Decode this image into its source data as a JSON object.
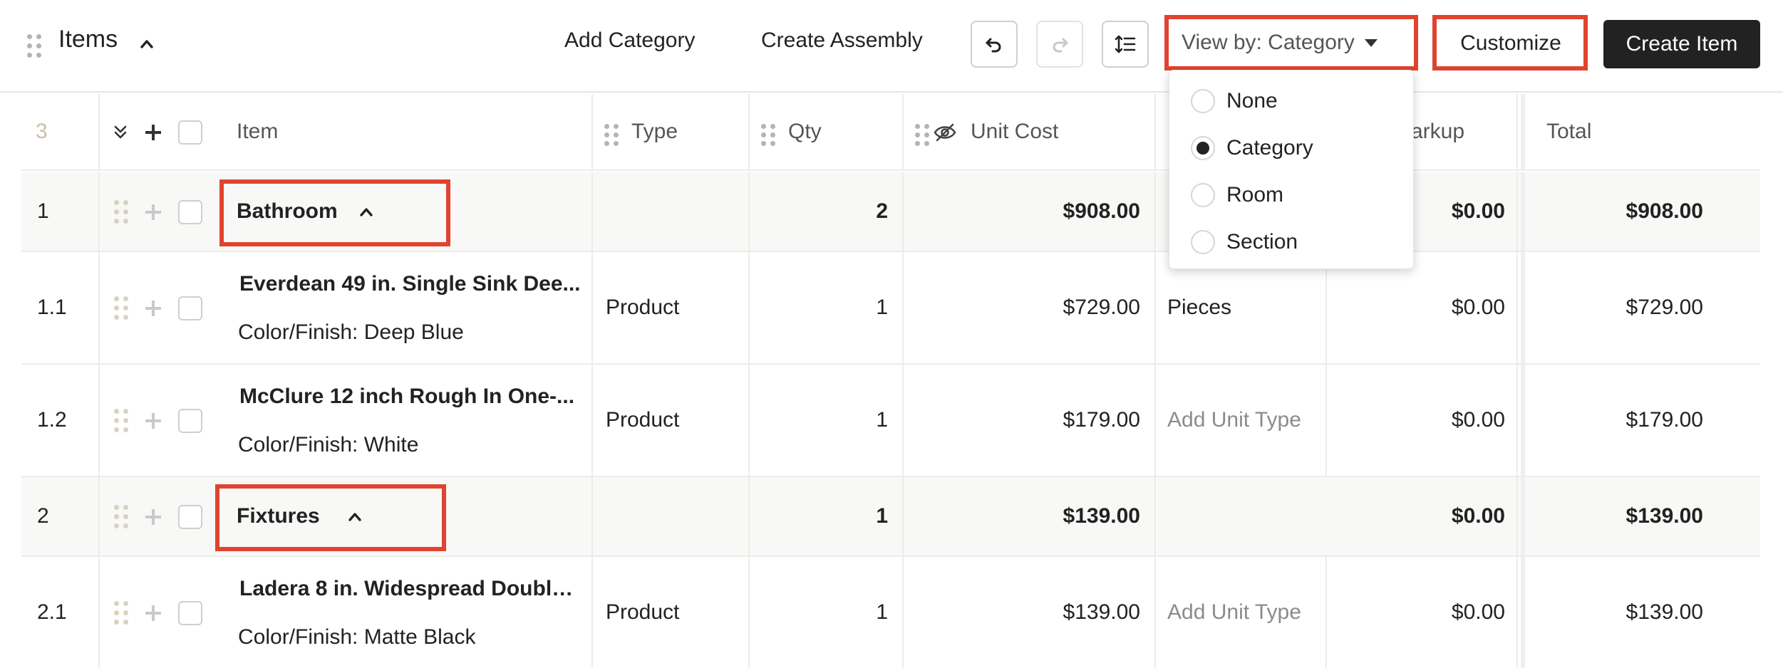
{
  "header": {
    "title": "Items",
    "add_category": "Add Category",
    "create_assembly": "Create Assembly",
    "view_by": "View by: Category",
    "customize": "Customize",
    "create_item": "Create Item"
  },
  "columns": {
    "count": "3",
    "item": "Item",
    "type": "Type",
    "qty": "Qty",
    "unit_cost": "Unit Cost",
    "markup": "arkup",
    "total": "Total"
  },
  "rows": [
    {
      "num": "1",
      "name": "Bathroom",
      "qty": "2",
      "unit_cost": "$908.00",
      "markup": "$0.00",
      "total": "$908.00"
    },
    {
      "num": "1.1",
      "name": "Everdean 49 in. Single Sink Dee...",
      "sub": "Color/Finish: Deep Blue",
      "type": "Product",
      "qty": "1",
      "unit_cost": "$729.00",
      "unit": "Pieces",
      "markup": "$0.00",
      "total": "$729.00"
    },
    {
      "num": "1.2",
      "name": "McClure 12 inch Rough In One-...",
      "sub": "Color/Finish: White",
      "type": "Product",
      "qty": "1",
      "unit_cost": "$179.00",
      "unit": "Add Unit Type",
      "markup": "$0.00",
      "total": "$179.00"
    },
    {
      "num": "2",
      "name": "Fixtures",
      "qty": "1",
      "unit_cost": "$139.00",
      "markup": "$0.00",
      "total": "$139.00"
    },
    {
      "num": "2.1",
      "name": "Ladera 8 in. Widespread Double ...",
      "sub": "Color/Finish: Matte Black",
      "type": "Product",
      "qty": "1",
      "unit_cost": "$139.00",
      "unit": "Add Unit Type",
      "markup": "$0.00",
      "total": "$139.00"
    }
  ],
  "view_by_menu": {
    "options": [
      "None",
      "Category",
      "Room",
      "Section"
    ],
    "selected": "Category"
  },
  "colors": {
    "highlight": "#e0432f",
    "primary_button": "#222222"
  }
}
